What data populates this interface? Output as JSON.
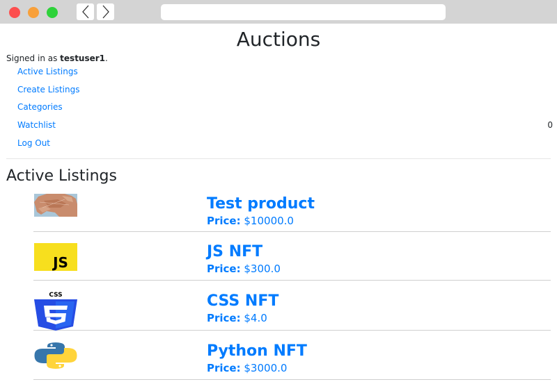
{
  "header": {
    "title": "Auctions"
  },
  "user": {
    "prefix": "Signed in as ",
    "username": "testuser1",
    "suffix": "."
  },
  "nav": [
    {
      "label": "Active Listings"
    },
    {
      "label": "Create Listings"
    },
    {
      "label": "Categories"
    },
    {
      "label": "Watchlist"
    },
    {
      "label": "Log Out"
    }
  ],
  "watchlist_count": "0",
  "section": {
    "title": "Active Listings"
  },
  "price_label": "Price:",
  "listings": [
    {
      "title": "Test product",
      "price": "$10000.0",
      "image": "map-image"
    },
    {
      "title": "JS NFT",
      "price": "$300.0",
      "image": "js-logo",
      "image_text": "JS"
    },
    {
      "title": "CSS NFT",
      "price": "$4.0",
      "image": "css3-logo",
      "image_text": "CSS"
    },
    {
      "title": "Python NFT",
      "price": "$3000.0",
      "image": "python-logo"
    }
  ],
  "colors": {
    "link": "#007bff",
    "chrome": "#d4d4d4",
    "js_yellow": "#f7df1e",
    "css_blue": "#264de4"
  }
}
